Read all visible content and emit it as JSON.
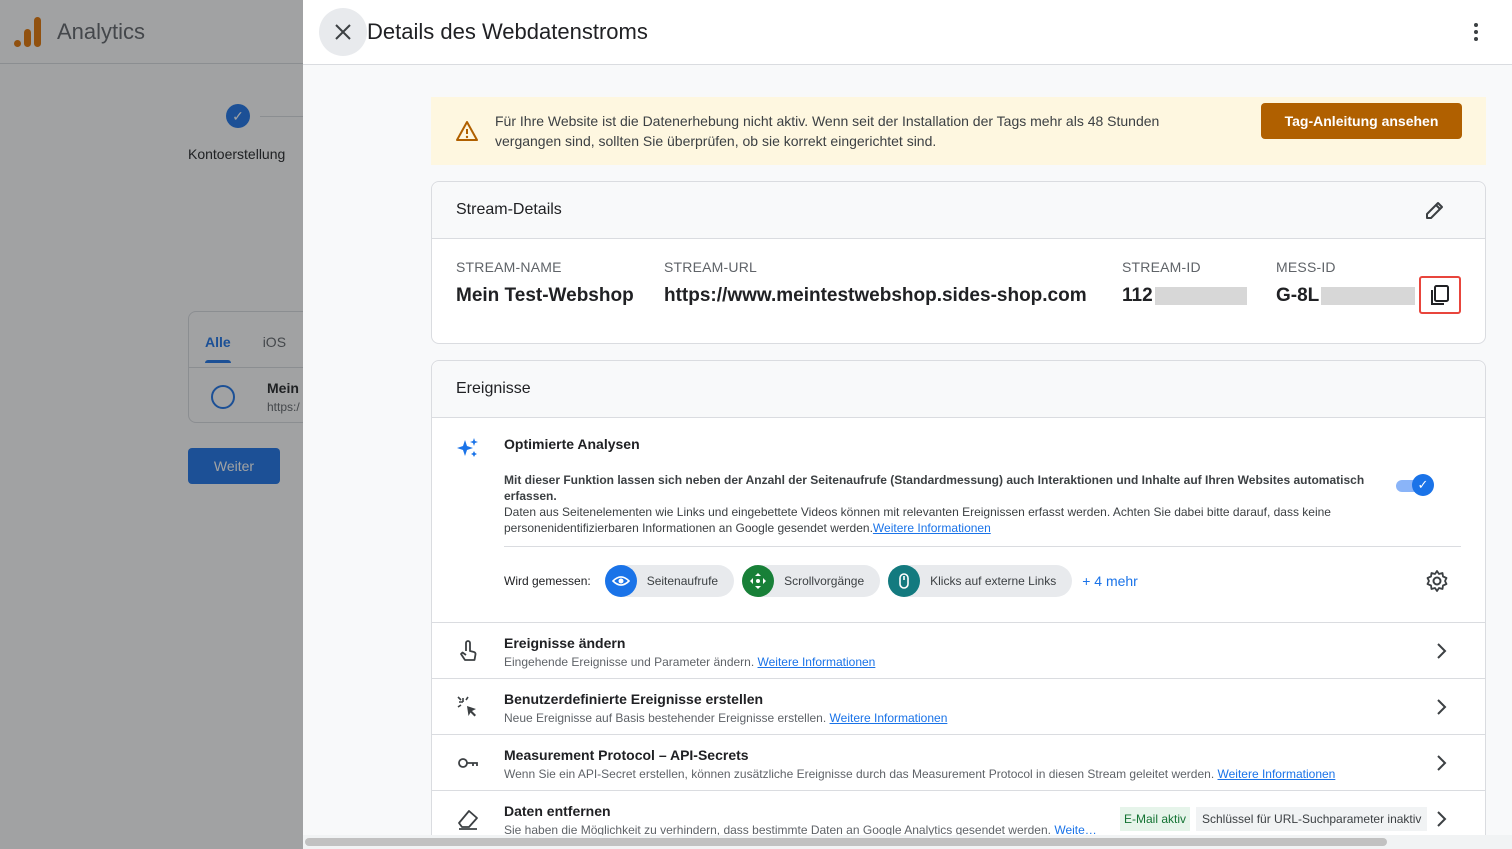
{
  "background": {
    "app_name": "Analytics",
    "step_label": "Kontoerstellung",
    "tabs": [
      "Alle",
      "iOS"
    ],
    "row_title": "Mein",
    "row_subtitle": "https:/",
    "next_button": "Weiter"
  },
  "panel": {
    "title": "Details des Webdatenstroms",
    "warning": {
      "text": "Für Ihre Website ist die Datenerhebung nicht aktiv. Wenn seit der Installation der Tags mehr als 48 Stunden vergangen sind, sollten Sie überprüfen, ob sie korrekt eingerichtet sind.",
      "button": "Tag-Anleitung ansehen"
    },
    "stream_details": {
      "heading": "Stream-Details",
      "stream_name_label": "STREAM-NAME",
      "stream_name": "Mein Test-Webshop",
      "stream_url_label": "STREAM-URL",
      "stream_url": "https://www.meintestwebshop.sides-shop.com",
      "stream_id_label": "STREAM-ID",
      "stream_id_visible": "112",
      "mess_id_label": "MESS-ID",
      "mess_id_visible": "G-8L"
    },
    "events": {
      "heading": "Ereignisse",
      "optimized": {
        "title": "Optimierte Analysen",
        "desc_bold": "Mit dieser Funktion lassen sich neben der Anzahl der Seitenaufrufe (Standardmessung) auch Interaktionen und Inhalte auf Ihren Websites automatisch erfassen.",
        "desc": "Daten aus Seitenelementen wie Links und eingebettete Videos können mit relevanten Ereignissen erfasst werden. Achten Sie dabei bitte darauf, dass keine personenidentifizierbaren Informationen an Google gesendet werden.",
        "link": "Weitere Informationen",
        "enabled": true,
        "measured_label": "Wird gemessen:",
        "chips": [
          "Seitenaufrufe",
          "Scrollvorgänge",
          "Klicks auf externe Links"
        ],
        "more": "+ 4 mehr"
      },
      "rows": [
        {
          "title": "Ereignisse ändern",
          "sub": "Eingehende Ereignisse und Parameter ändern.",
          "link": "Weitere Informationen"
        },
        {
          "title": "Benutzerdefinierte Ereignisse erstellen",
          "sub": "Neue Ereignisse auf Basis bestehender Ereignisse erstellen.",
          "link": "Weitere Informationen"
        },
        {
          "title": "Measurement Protocol – API-Secrets",
          "sub": "Wenn Sie ein API-Secret erstellen, können zusätzliche Ereignisse durch das Measurement Protocol in diesen Stream geleitet werden.",
          "link": "Weitere Informationen"
        },
        {
          "title": "Daten entfernen",
          "sub": "Sie haben die Möglichkeit zu verhindern, dass bestimmte Daten an Google Analytics gesendet werden.",
          "link": "Weite…",
          "badge_on": "E-Mail aktiv",
          "badge_off": "Schlüssel für URL-Suchparameter inaktiv"
        }
      ]
    }
  },
  "colors": {
    "accent": "#1a73e8",
    "warning_bg": "#fef7e0",
    "warning_button": "#b06000",
    "copy_highlight": "#e8453c"
  }
}
